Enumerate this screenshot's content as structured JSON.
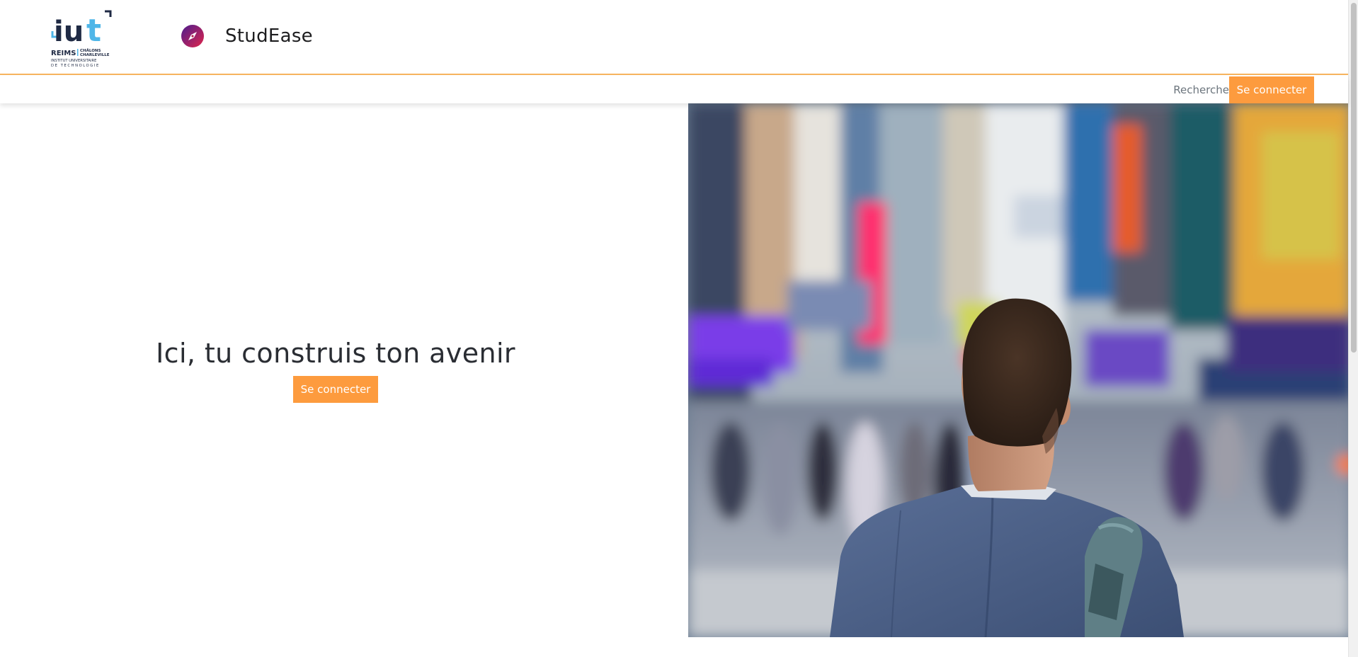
{
  "header": {
    "logo_alt": "IUT Reims Châlons Charleville – Institut Universitaire de Technologie",
    "logo_text": {
      "brand": "iut",
      "campus_left": "REIMS",
      "campus_right_1": "CHÂLONS",
      "campus_right_2": "CHARLEVILLE",
      "tagline_1": "INSTITUT UNIVERSITAIRE",
      "tagline_2": "DE TECHNOLOGIE"
    },
    "app_icon": "compass-icon",
    "app_title": "StudEase"
  },
  "navbar": {
    "search_label": "Recherche",
    "login_label": "Se connecter"
  },
  "hero": {
    "title": "Ici, tu construis ton avenir",
    "button_label": "Se connecter",
    "image_description": "man-in-city-street-photo"
  },
  "colors": {
    "accent": "#fd9b3e",
    "header_border": "#f6b45e",
    "logo_blue": "#4fb6e8",
    "logo_navy": "#1f2a44",
    "icon_gradient_start": "#4b1d8f",
    "icon_gradient_end": "#e0244a"
  }
}
